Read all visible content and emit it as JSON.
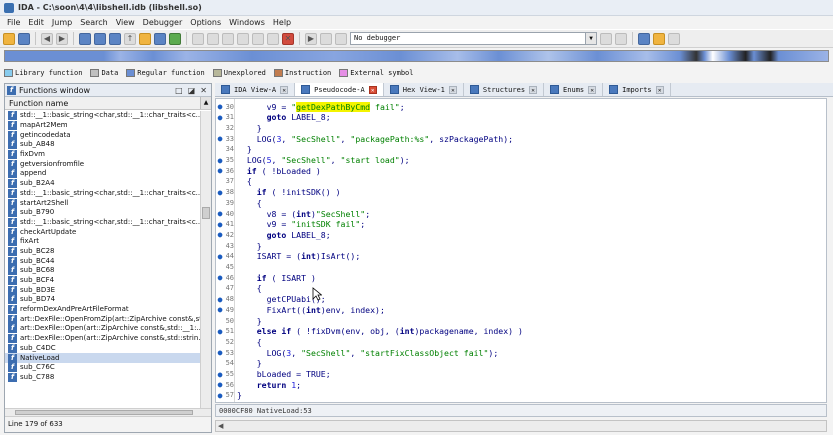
{
  "window": {
    "title": "IDA - C:\\soon\\4\\4\\libshell.idb (libshell.so)"
  },
  "menu": [
    "File",
    "Edit",
    "Jump",
    "Search",
    "View",
    "Debugger",
    "Options",
    "Windows",
    "Help"
  ],
  "toolbar": {
    "debugger_select": "No debugger"
  },
  "legend": [
    {
      "label": "Library function",
      "color": "#88ccee"
    },
    {
      "label": "Data",
      "color": "#c0c0c0"
    },
    {
      "label": "Regular function",
      "color": "#6b8fd4"
    },
    {
      "label": "Unexplored",
      "color": "#b7b79a"
    },
    {
      "label": "Instruction",
      "color": "#c27c4e"
    },
    {
      "label": "External symbol",
      "color": "#e58fe5"
    }
  ],
  "functions_window": {
    "title": "Functions window",
    "column_header": "Function name",
    "items": [
      "std::__1::basic_string<char,std::__1::char_traits<c...",
      "mapArt2Mem",
      "getincodedata",
      "sub_AB48",
      "fixDvm",
      "getversionfromfile",
      "append",
      "sub_B2A4",
      "std::__1::basic_string<char,std::__1::char_traits<c...",
      "startArt2Shell",
      "sub_B790",
      "std::__1::basic_string<char,std::__1::char_traits<c...",
      "checkArtUpdate",
      "fixArt",
      "sub_BC28",
      "sub_BC44",
      "sub_BC68",
      "sub_BCF4",
      "sub_BD3E",
      "sub_BD74",
      "reformDexAndPreArtFileFormat",
      "art::DexFile::OpenFromZip(art::ZipArchive const&,st...",
      "art::DexFile::Open(art::ZipArchive const&,std::__1:...",
      "art::DexFile::Open(art::ZipArchive const&,std::strin...",
      "sub_C4DC",
      "NativeLoad",
      "sub_C76C",
      "sub_C788"
    ],
    "selected_index": 25,
    "status": "Line 179 of 633"
  },
  "tabs": [
    {
      "label": "IDA View-A",
      "active": false
    },
    {
      "label": "Pseudocode-A",
      "active": true
    },
    {
      "label": "Hex View-1",
      "active": false
    },
    {
      "label": "Structures",
      "active": false
    },
    {
      "label": "Enums",
      "active": false
    },
    {
      "label": "Imports",
      "active": false
    }
  ],
  "code": {
    "lines": [
      {
        "n": "30",
        "dot": true,
        "t": "      v9 = \"getDexPathByCmd fail\";"
      },
      {
        "n": "31",
        "dot": true,
        "t": "      goto LABEL_8;"
      },
      {
        "n": "32",
        "dot": false,
        "t": "    }"
      },
      {
        "n": "33",
        "dot": true,
        "t": "    LOG(3, \"SecShell\", \"packagePath:%s\", szPackagePath);"
      },
      {
        "n": "34",
        "dot": false,
        "t": "  }"
      },
      {
        "n": "35",
        "dot": true,
        "t": "  LOG(5, \"SecShell\", \"start load\");"
      },
      {
        "n": "36",
        "dot": true,
        "t": "  if ( !bLoaded )"
      },
      {
        "n": "37",
        "dot": false,
        "t": "  {"
      },
      {
        "n": "38",
        "dot": true,
        "t": "    if ( !initSDK() )"
      },
      {
        "n": "39",
        "dot": false,
        "t": "    {"
      },
      {
        "n": "40",
        "dot": true,
        "t": "      v8 = (int)\"SecShell\";"
      },
      {
        "n": "41",
        "dot": true,
        "t": "      v9 = \"initSDK fail\";"
      },
      {
        "n": "42",
        "dot": true,
        "t": "      goto LABEL_8;"
      },
      {
        "n": "43",
        "dot": false,
        "t": "    }"
      },
      {
        "n": "44",
        "dot": true,
        "t": "    ISART = (int)IsArt();"
      },
      {
        "n": "45",
        "dot": false,
        "t": ""
      },
      {
        "n": "46",
        "dot": true,
        "t": "    if ( ISART )"
      },
      {
        "n": "47",
        "dot": false,
        "t": "    {"
      },
      {
        "n": "48",
        "dot": true,
        "t": "      getCPUabi();"
      },
      {
        "n": "49",
        "dot": true,
        "t": "      FixArt((int)env, index);"
      },
      {
        "n": "50",
        "dot": false,
        "t": "    }"
      },
      {
        "n": "51",
        "dot": true,
        "t": "    else if ( !fixDvm(env, obj, (int)packagename, index) )"
      },
      {
        "n": "52",
        "dot": false,
        "t": "    {"
      },
      {
        "n": "53",
        "dot": true,
        "t": "      LOG(3, \"SecShell\", \"startFixClassObject fail\");"
      },
      {
        "n": "54",
        "dot": false,
        "t": "    }"
      },
      {
        "n": "55",
        "dot": true,
        "t": "    bLoaded = TRUE;"
      },
      {
        "n": "56",
        "dot": true,
        "t": "    return 1;"
      },
      {
        "n": "57",
        "dot": true,
        "t": "}"
      }
    ],
    "footer": "0000CF80 NativeLoad:53"
  }
}
